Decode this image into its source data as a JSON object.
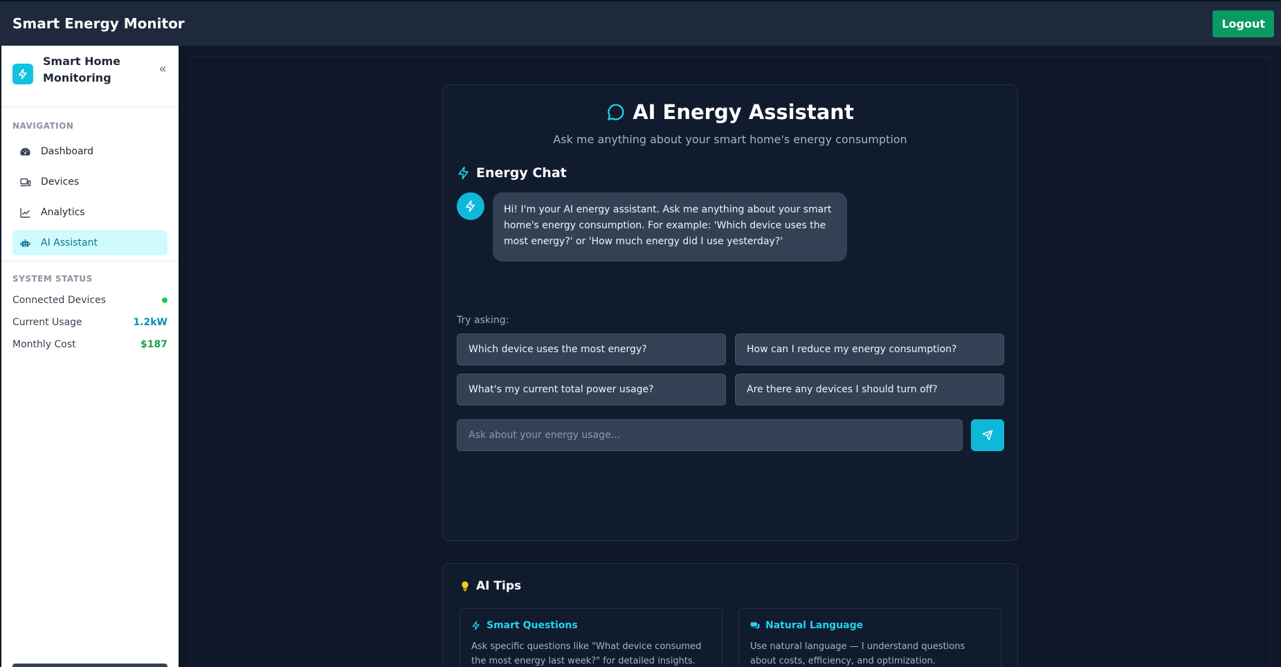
{
  "header": {
    "title": "Smart Energy Monitor",
    "logout_label": "Logout"
  },
  "sidebar": {
    "title_line1": "Smart Home",
    "title_line2": "Monitoring",
    "nav_label": "NAVIGATION",
    "items": [
      {
        "label": "Dashboard",
        "icon": "dashboard-icon"
      },
      {
        "label": "Devices",
        "icon": "devices-icon"
      },
      {
        "label": "Analytics",
        "icon": "analytics-icon"
      },
      {
        "label": "AI Assistant",
        "icon": "robot-icon",
        "active": true
      }
    ],
    "status_label": "SYSTEM STATUS",
    "status": {
      "connected_label": "Connected Devices",
      "usage_label": "Current Usage",
      "usage_value": "1.2kW",
      "cost_label": "Monthly Cost",
      "cost_value": "$187"
    }
  },
  "chat": {
    "title": "AI Energy Assistant",
    "subtitle": "Ask me anything about your smart home's energy consumption",
    "section_title": "Energy Chat",
    "greeting": "Hi! I'm your AI energy assistant. Ask me anything about your smart home's energy consumption. For example: 'Which device uses the most energy?' or 'How much energy did I use yesterday?'",
    "try_label": "Try asking:",
    "suggestions": [
      "Which device uses the most energy?",
      "How can I reduce my energy consumption?",
      "What's my current total power usage?",
      "Are there any devices I should turn off?"
    ],
    "input_placeholder": "Ask about your energy usage..."
  },
  "tips": {
    "title": "AI Tips",
    "items": [
      {
        "title": "Smart Questions",
        "text": "Ask specific questions like \"What device consumed the most energy last week?\" for detailed insights."
      },
      {
        "title": "Natural Language",
        "text": "Use natural language — I understand questions about costs, efficiency, and optimization."
      }
    ]
  },
  "colors": {
    "accent": "#13c2e0",
    "success": "#0a9a64",
    "background": "#0f172a"
  }
}
